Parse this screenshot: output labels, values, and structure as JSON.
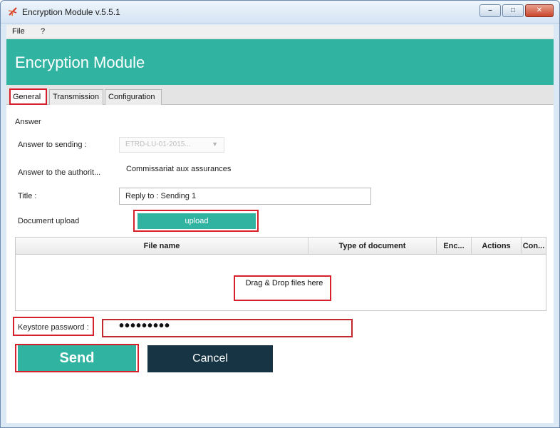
{
  "window": {
    "title": "Encryption Module v.5.5.1",
    "accent_color": "#30b3a1",
    "dark_button_color": "#173444",
    "highlight_color": "#d6202a",
    "controls": {
      "minimize": "–",
      "maximize": "□",
      "close": "✕"
    }
  },
  "menu": {
    "items": [
      "File",
      "?"
    ]
  },
  "banner": {
    "title": "Encryption Module"
  },
  "tabs": [
    {
      "label": "General",
      "active": true
    },
    {
      "label": "Transmission",
      "active": false
    },
    {
      "label": "Configuration",
      "active": false
    }
  ],
  "form": {
    "section_label": "Answer",
    "answer_to_sending": {
      "label": "Answer to sending :",
      "value": "ETRD-LU-01-2015...",
      "disabled": true
    },
    "answer_to_authority": {
      "label": "Answer to the authorit...",
      "value": "Commissariat aux assurances"
    },
    "title": {
      "label": "Title :",
      "value": "Reply to : Sending 1"
    },
    "document_upload": {
      "label": "Document upload",
      "button": "upload"
    }
  },
  "table": {
    "columns": [
      "File name",
      "Type of document",
      "Enc...",
      "Actions",
      "Con..."
    ],
    "rows": [],
    "empty_text": "Drag & Drop files here"
  },
  "keystore": {
    "label": "Keystore password :",
    "value": "•••••••••"
  },
  "actions": {
    "send": "Send",
    "cancel": "Cancel"
  }
}
